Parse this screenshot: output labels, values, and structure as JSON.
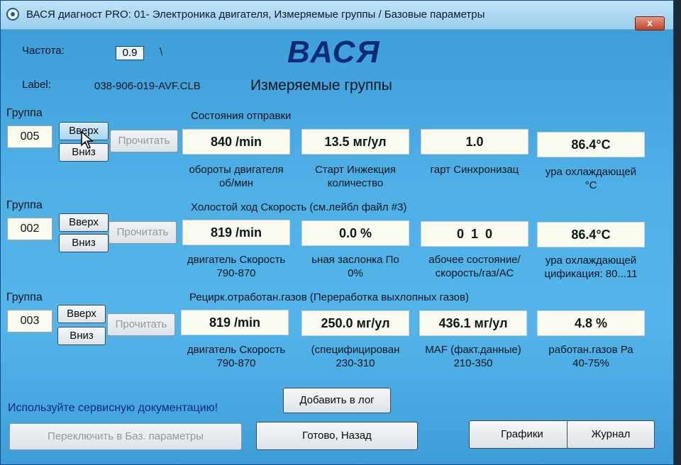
{
  "window": {
    "title": "ВАСЯ диагност PRO: 01- Электроника двигателя,  Измеряемые группы / Базовые параметры",
    "close_label": "x"
  },
  "header": {
    "freq_label": "Частота:",
    "freq_value": "0.9",
    "freq_suffix": "\\",
    "label_label": "Label:",
    "label_value": "038-906-019-AVF.CLB",
    "logo": "ВАСЯ",
    "subtitle": "Измеряемые группы"
  },
  "groups": [
    {
      "label": "Группа",
      "number": "005",
      "up": "Вверх",
      "down": "Вниз",
      "read": "Прочитать",
      "title": "Состояния отправки",
      "values": [
        "840 /min",
        "13.5 мг/ул",
        "1.0",
        "86.4°C"
      ],
      "captions": [
        [
          "обороты двигателя",
          "об/мин"
        ],
        [
          "Старт Инжекция",
          "количество"
        ],
        [
          "гарт Синхронизац",
          ""
        ],
        [
          "ура охлаждающей",
          "°C"
        ]
      ]
    },
    {
      "label": "Группа",
      "number": "002",
      "up": "Вверх",
      "down": "Вниз",
      "read": "Прочитать",
      "title": "Холостой ход Скорость (см.лейбл файл #3)",
      "values": [
        "819 /min",
        "0.0 %",
        "0  1  0",
        "86.4°C"
      ],
      "captions": [
        [
          "двигатель Скорость",
          "790-870"
        ],
        [
          "ьная заслонка По",
          "0%"
        ],
        [
          "абочее состояние/",
          "скорость/газ/АС"
        ],
        [
          "ура охлаждающей",
          "цификация: 80...11"
        ]
      ]
    },
    {
      "label": "Группа",
      "number": "003",
      "up": "Вверх",
      "down": "Вниз",
      "read": "Прочитать",
      "title": "Рецирк.отработан.газов (Переработка выхлопных газов)",
      "values": [
        "819 /min",
        "250.0 мг/ул",
        "436.1 мг/ул",
        "4.8 %"
      ],
      "captions": [
        [
          "двигатель Скорость",
          "790-870"
        ],
        [
          "(специфицирован",
          "230-310"
        ],
        [
          "MAF (факт.данные)",
          "210-350"
        ],
        [
          "работан.газов Ра",
          "40-75%"
        ]
      ]
    }
  ],
  "footer": {
    "hint": "Используйте сервисную документацию!",
    "add_log": "Добавить в лог",
    "switch_basic": "Переключить в Баз. параметры",
    "done_back": "Готово, Назад",
    "graphs": "Графики",
    "journal": "Журнал"
  }
}
